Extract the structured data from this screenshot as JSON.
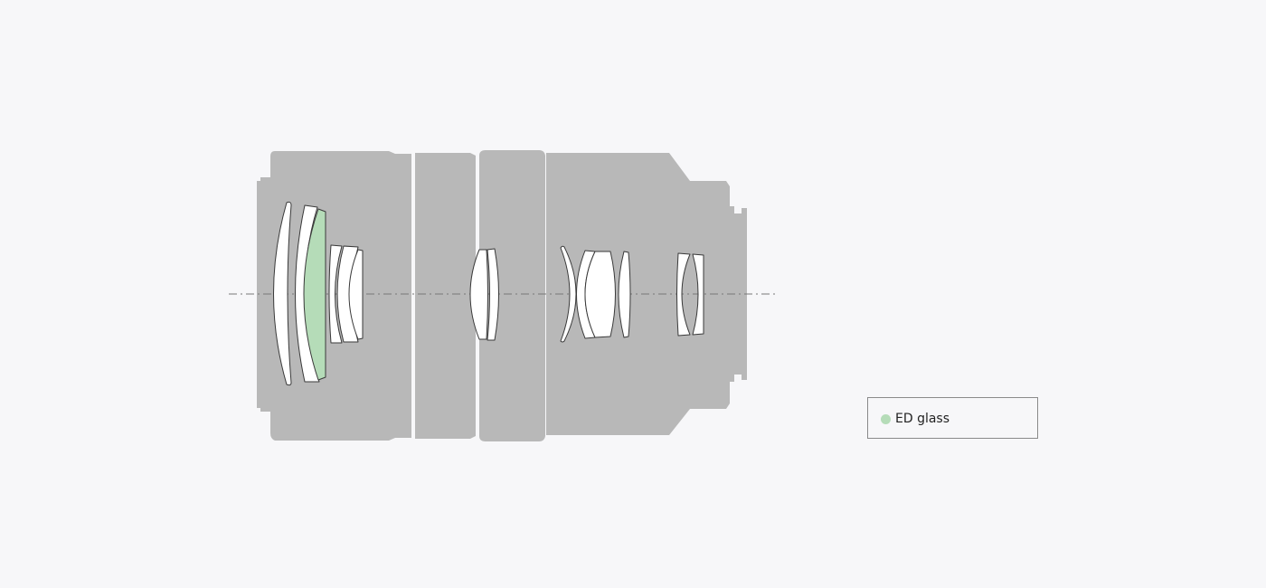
{
  "colors": {
    "background": "#f7f7f9",
    "barrel": "#b8b8b8",
    "lens_element": "#ffffff",
    "ed_glass": "#b5dcb8",
    "outline": "#3a3a3a",
    "optical_axis": "#777777"
  },
  "diagram": {
    "element_count": 14,
    "ed_glass_element_count": 1,
    "optical_axis": "dash-dot"
  },
  "legend": {
    "items": [
      {
        "label": "ED glass",
        "color_key": "ed_glass"
      }
    ]
  }
}
